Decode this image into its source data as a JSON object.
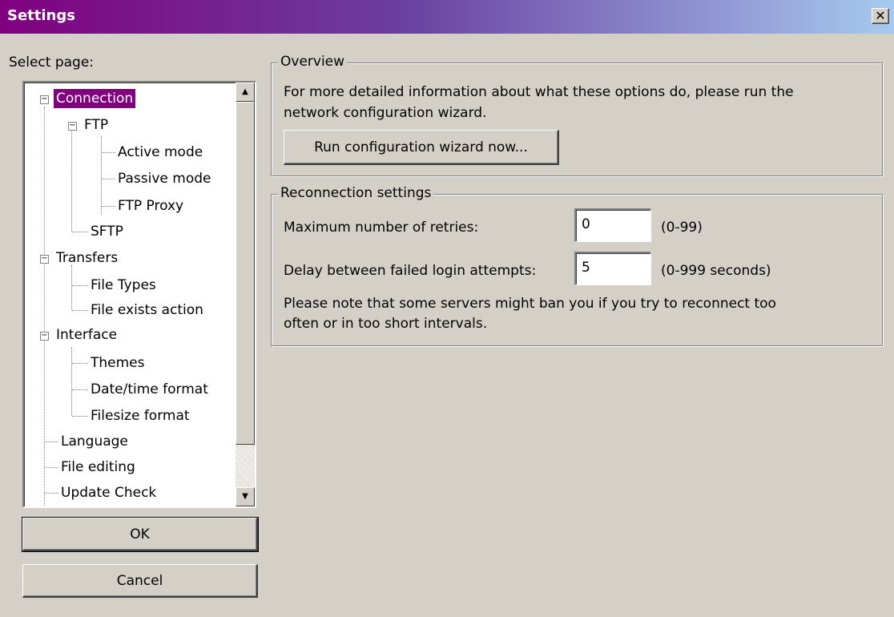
{
  "window": {
    "title": "Settings",
    "close_glyph": "✕"
  },
  "sidebar": {
    "select_label": "Select page:",
    "tree": [
      {
        "label": "Connection",
        "expander": "−"
      },
      {
        "label": "FTP",
        "expander": "−"
      },
      {
        "label": "Active mode"
      },
      {
        "label": "Passive mode"
      },
      {
        "label": "FTP Proxy"
      },
      {
        "label": "SFTP"
      },
      {
        "label": "Transfers",
        "expander": "−"
      },
      {
        "label": "File Types"
      },
      {
        "label": "File exists action"
      },
      {
        "label": "Interface",
        "expander": "−"
      },
      {
        "label": "Themes"
      },
      {
        "label": "Date/time format"
      },
      {
        "label": "Filesize format"
      },
      {
        "label": "Language"
      },
      {
        "label": "File editing"
      },
      {
        "label": "Update Check"
      }
    ],
    "selected": "Connection",
    "ok_label": "OK",
    "cancel_label": "Cancel"
  },
  "overview": {
    "legend": "Overview",
    "line1": "For more detailed information about what these options do, please run the",
    "line2": "network configuration wizard.",
    "wizard_button": "Run configuration wizard now..."
  },
  "reconnection": {
    "legend": "Reconnection settings",
    "retries_label": "Maximum number of retries:",
    "retries_value": "0",
    "retries_range": "(0-99)",
    "delay_label": "Delay between failed login attempts:",
    "delay_value": "5",
    "delay_range": "(0-999 seconds)",
    "note_line1": "Please note that some servers might ban you if you try to reconnect too",
    "note_line2": "often or in too short intervals."
  },
  "icons": {
    "close": "close-icon",
    "scroll_up": "arrow-up-icon",
    "scroll_down": "arrow-down-icon",
    "expander": "collapse-icon"
  },
  "colors": {
    "titlebar_start": "#800080",
    "titlebar_end": "#a6caf0",
    "selection": "#800080",
    "face": "#d4d0c8"
  }
}
